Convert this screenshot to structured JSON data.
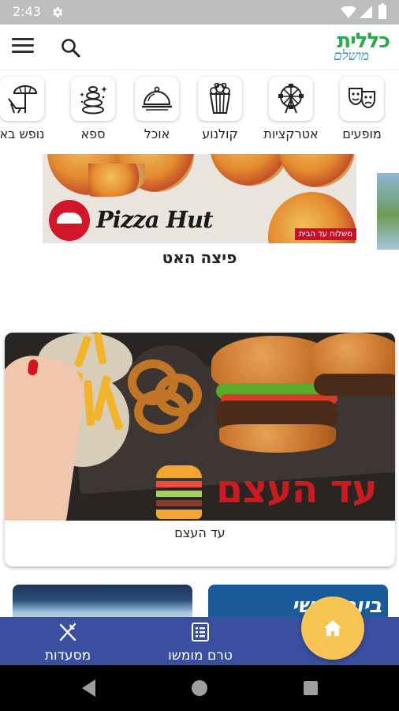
{
  "status_bar": {
    "time": "2:43",
    "icons": [
      "gear-icon",
      "wifi-icon",
      "signal-icon",
      "battery-icon"
    ]
  },
  "app_bar": {
    "icons": [
      "menu-icon",
      "search-icon"
    ],
    "logo": {
      "main_text": "כללית",
      "sub_text": "מושלם"
    }
  },
  "categories": [
    {
      "label": "מופעים",
      "icon": "theater-masks-icon"
    },
    {
      "label": "אטרקציות",
      "icon": "ferris-wheel-icon"
    },
    {
      "label": "קולנוע",
      "icon": "popcorn-icon"
    },
    {
      "label": "אוכל",
      "icon": "food-tray-icon"
    },
    {
      "label": "ספא",
      "icon": "spa-stones-icon"
    },
    {
      "label": "נופש בא",
      "icon": "beach-chair-icon"
    }
  ],
  "banner": {
    "brand": "Pizza Hut",
    "tag": "משלוח עד הבית",
    "title": "פיצה האט"
  },
  "card": {
    "brand_text": "עד העצם",
    "caption": "עד העצם"
  },
  "peek_right_text": "ביום שישי",
  "bottom_nav": {
    "items": [
      {
        "label": "מסעדות",
        "icon": "fork-knife-icon"
      },
      {
        "label": "טרם מומשו",
        "icon": "list-icon"
      }
    ],
    "fab_icon": "home-icon"
  },
  "colors": {
    "bottom_nav": "#3a4fa0",
    "fab": "#f8c555",
    "logo_green": "#2aa84a",
    "logo_blue": "#1e90c8",
    "pizza_hut_red": "#d2162a",
    "brand_red": "#ca1a22"
  }
}
